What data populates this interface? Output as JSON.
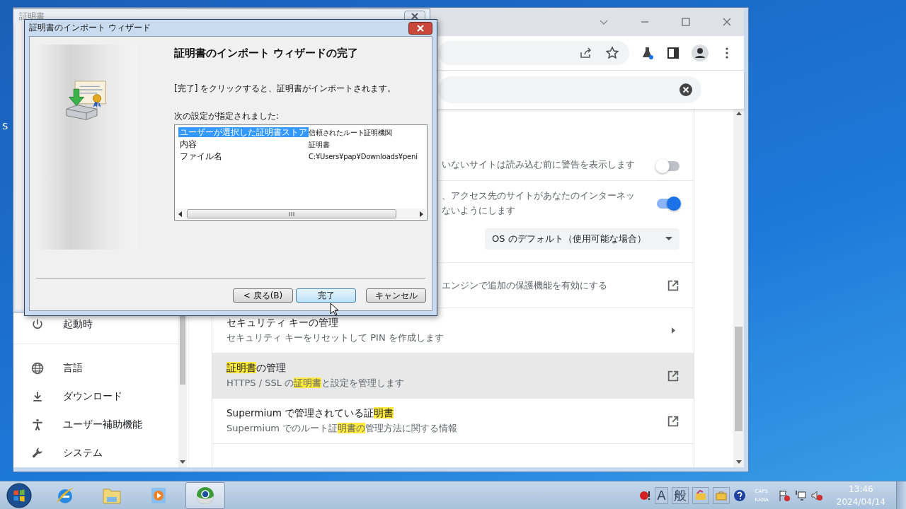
{
  "desktop": {
    "icon_label": "S"
  },
  "back_window": {
    "title": "証明書"
  },
  "wizard": {
    "title": "証明書のインポート ウィザード",
    "heading": "証明書のインポート ウィザードの完了",
    "instruction": "[完了] をクリックすると、証明書がインポートされます。",
    "settings_label": "次の設定が指定されました:",
    "settings": [
      {
        "name": "ユーザーが選択した証明書ストア",
        "value": "信頼されたルート証明機関",
        "selected": true
      },
      {
        "name": "内容",
        "value": "証明書",
        "selected": false
      },
      {
        "name": "ファイル名",
        "value": "C:¥Users¥pap¥Downloads¥peni",
        "selected": false
      }
    ],
    "buttons": [
      {
        "label": "< 戻る(B)",
        "default": false
      },
      {
        "label": "完了",
        "default": true
      },
      {
        "label": "キャンセル",
        "default": false
      }
    ]
  },
  "browser": {
    "sidebar": {
      "items": [
        {
          "kind": "power",
          "label": "起動時",
          "separator_after": true
        },
        {
          "kind": "globe",
          "label": "言語",
          "separator_after": false
        },
        {
          "kind": "download",
          "label": "ダウンロード",
          "separator_after": false
        },
        {
          "kind": "accessibility",
          "label": "ユーザー補助機能",
          "separator_after": false
        },
        {
          "kind": "wrench",
          "label": "システム",
          "separator_after": false
        }
      ]
    },
    "settings_rows": [
      {
        "kind": "toggle",
        "on": false,
        "highlighted": false,
        "description": [
          [
            {
              "text": "いないサイトは読み込む前に警告を表示します",
              "highlight": false
            }
          ]
        ]
      },
      {
        "kind": "toggle",
        "on": true,
        "highlighted": false,
        "description": [
          [
            {
              "text": "、アクセス先のサイトがあなたのインターネッ",
              "highlight": false
            }
          ],
          [
            {
              "text": "ないようにします",
              "highlight": false
            }
          ]
        ]
      },
      {
        "kind": "dropdown",
        "value": "OS のデフォルト（使用可能な場合）"
      },
      {
        "kind": "external",
        "highlighted": false,
        "description": [
          [
            {
              "text": "エンジンで追加の保護機能を有効にする",
              "highlight": false
            }
          ]
        ]
      },
      {
        "kind": "arrow",
        "highlighted": false,
        "title": [
          {
            "text": "セキュリティ キーの管理",
            "highlight": false
          }
        ],
        "description": [
          [
            {
              "text": "セキュリティ キーをリセットして PIN を作成します",
              "highlight": false
            }
          ]
        ]
      },
      {
        "kind": "external",
        "highlighted": true,
        "title": [
          {
            "text": "証明書",
            "highlight": true
          },
          {
            "text": "の管理",
            "highlight": false
          }
        ],
        "description": [
          [
            {
              "text": "HTTPS / SSL の",
              "highlight": false
            },
            {
              "text": "証明書",
              "highlight": true
            },
            {
              "text": "と設定を管理します",
              "highlight": false
            }
          ]
        ]
      },
      {
        "kind": "external",
        "highlighted": false,
        "title": [
          {
            "text": "Supermium で管理されている証",
            "highlight": false
          },
          {
            "text": "明書",
            "highlight": true
          }
        ],
        "description": [
          [
            {
              "text": "Supermium でのルート証",
              "highlight": false
            },
            {
              "text": "明書の",
              "highlight": true
            },
            {
              "text": "管理方法に関する情報",
              "highlight": false
            }
          ]
        ]
      }
    ]
  },
  "taskbar": {
    "apps": [
      {
        "kind": "start",
        "selected": false
      },
      {
        "kind": "ie",
        "selected": false
      },
      {
        "kind": "explorer",
        "selected": false
      },
      {
        "kind": "media",
        "selected": false
      },
      {
        "kind": "supermium",
        "selected": true
      }
    ],
    "tray": {
      "ime_mode": "A",
      "ime_dict": "般",
      "caps": "CAPS",
      "kana": "KANA",
      "time": "13:46",
      "date": "2024/04/14"
    }
  }
}
